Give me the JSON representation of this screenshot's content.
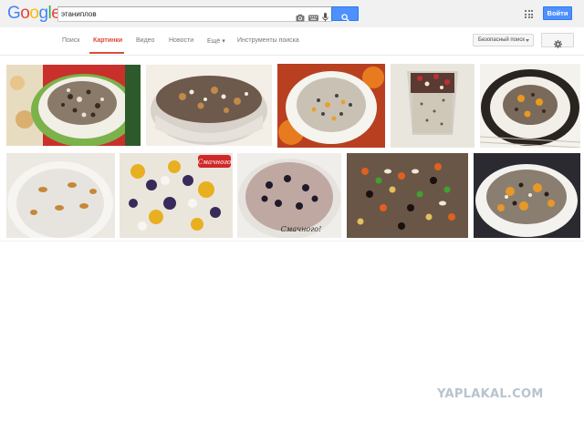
{
  "header": {
    "logo_letters": [
      {
        "ch": "G",
        "color": "#4285f4"
      },
      {
        "ch": "o",
        "color": "#ea4335"
      },
      {
        "ch": "o",
        "color": "#fbbc05"
      },
      {
        "ch": "g",
        "color": "#4285f4"
      },
      {
        "ch": "l",
        "color": "#34a853"
      },
      {
        "ch": "e",
        "color": "#ea4335"
      }
    ],
    "search_value": "этаниплов",
    "search_icons": [
      "camera-icon",
      "keyboard-icon",
      "microphone-icon"
    ],
    "search_button_icon": "search-icon",
    "apps_icon": "apps-grid-icon",
    "signin_label": "Войти"
  },
  "nav": {
    "tabs": [
      {
        "label": "Поиск",
        "active": false
      },
      {
        "label": "Картинки",
        "active": true
      },
      {
        "label": "Видео",
        "active": false
      },
      {
        "label": "Новости",
        "active": false
      },
      {
        "label": "Ещё ▾",
        "active": false
      },
      {
        "label": "Инструменты поиска",
        "active": false
      }
    ],
    "safe_search_label": "Безопасный поиск",
    "settings_icon": "gear-icon"
  },
  "results": {
    "images": [
      {
        "name": "kutia-with-nuts-plate",
        "overlay_text": ""
      },
      {
        "name": "kutia-crystal-bowl",
        "overlay_text": ""
      },
      {
        "name": "kutia-white-bowl-oranges",
        "overlay_text": ""
      },
      {
        "name": "kutia-glass-cup",
        "overlay_text": ""
      },
      {
        "name": "kutia-plate-dark-bg",
        "overlay_text": ""
      },
      {
        "name": "rice-with-raisins-bowl",
        "overlay_text": ""
      },
      {
        "name": "rice-dried-fruits-closeup",
        "overlay_text": "Смачного"
      },
      {
        "name": "rice-with-prunes",
        "overlay_text": "Смачного!"
      },
      {
        "name": "rice-candied-fruits",
        "overlay_text": ""
      },
      {
        "name": "kutia-plate-apricots",
        "overlay_text": ""
      }
    ]
  },
  "watermark": "YAPLAKAL.COM"
}
